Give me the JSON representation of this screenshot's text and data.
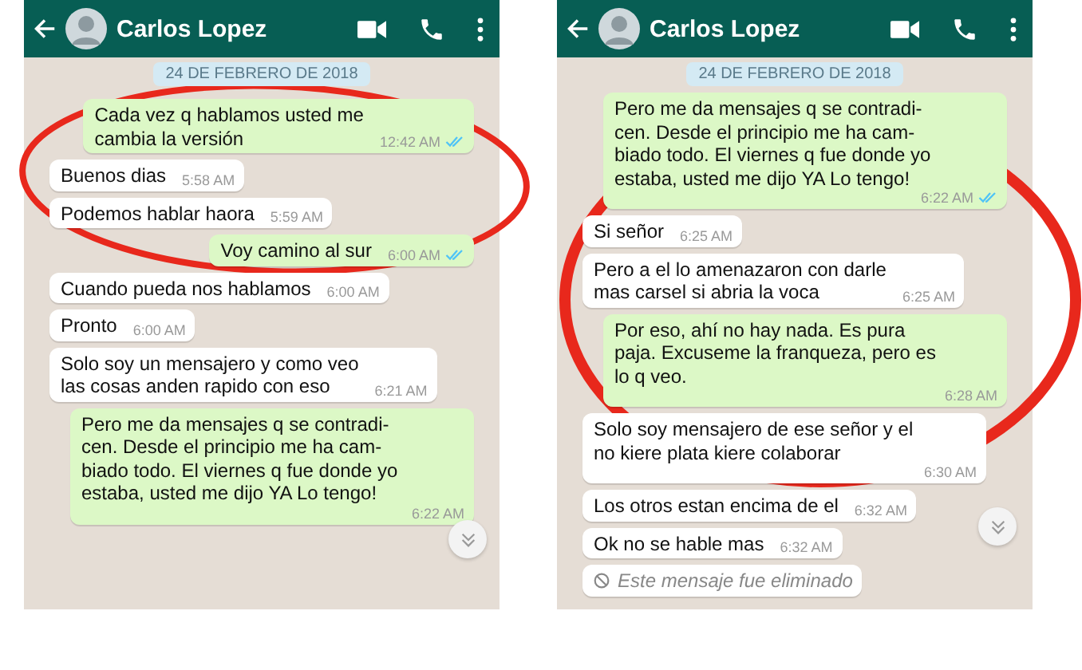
{
  "screens": [
    {
      "contact": "Carlos Lopez",
      "date_chip": "24 DE FEBRERO DE 2018",
      "messages": [
        {
          "kind": "out",
          "text": "Cada vez q hablamos usted me\ncambia la versión",
          "time": "12:42 AM",
          "read": true
        },
        {
          "kind": "in",
          "text": "Buenos dias",
          "time": "5:58 AM"
        },
        {
          "kind": "in",
          "text": "Podemos hablar haora",
          "time": "5:59 AM"
        },
        {
          "kind": "out",
          "text": "Voy camino al sur",
          "time": "6:00 AM",
          "read": true
        },
        {
          "kind": "in",
          "text": "Cuando pueda nos hablamos",
          "time": "6:00 AM"
        },
        {
          "kind": "in",
          "text": "Pronto",
          "time": "6:00 AM"
        },
        {
          "kind": "in",
          "text": "Solo soy un mensajero y como veo\nlas cosas anden rapido con eso",
          "time": "6:21 AM"
        },
        {
          "kind": "out",
          "text": "Pero me da mensajes q se contradi-\ncen. Desde el principio me ha cam-\nbiado todo. El viernes q fue donde yo\nestaba, usted me dijo YA Lo tengo!",
          "time": "6:22 AM",
          "read": false
        }
      ]
    },
    {
      "contact": "Carlos Lopez",
      "date_chip": "24 DE FEBRERO DE 2018",
      "messages": [
        {
          "kind": "out",
          "text": "Pero me da mensajes q se contradi-\ncen. Desde el principio me ha cam-\nbiado todo. El viernes q fue donde yo\nestaba, usted me dijo YA Lo tengo!",
          "time": "6:22 AM",
          "read": true
        },
        {
          "kind": "in",
          "text": "Si señor",
          "time": "6:25 AM"
        },
        {
          "kind": "in",
          "text": "Pero a el lo amenazaron con darle\nmas carsel si abria la voca",
          "time": "6:25 AM"
        },
        {
          "kind": "out",
          "text": "Por eso, ahí no hay nada. Es pura\npaja. Excuseme la franqueza, pero es\nlo q veo.",
          "time": "6:28 AM",
          "read": false
        },
        {
          "kind": "in",
          "text": "Solo soy mensajero de ese señor y el\nno kiere plata kiere colaborar",
          "time": "6:30 AM"
        },
        {
          "kind": "in",
          "text": "Los otros estan encima de el",
          "time": "6:32 AM"
        },
        {
          "kind": "in",
          "text": "Ok no se hable mas",
          "time": "6:32 AM"
        },
        {
          "kind": "deleted",
          "text": "Este mensaje fue eliminado"
        }
      ]
    }
  ]
}
